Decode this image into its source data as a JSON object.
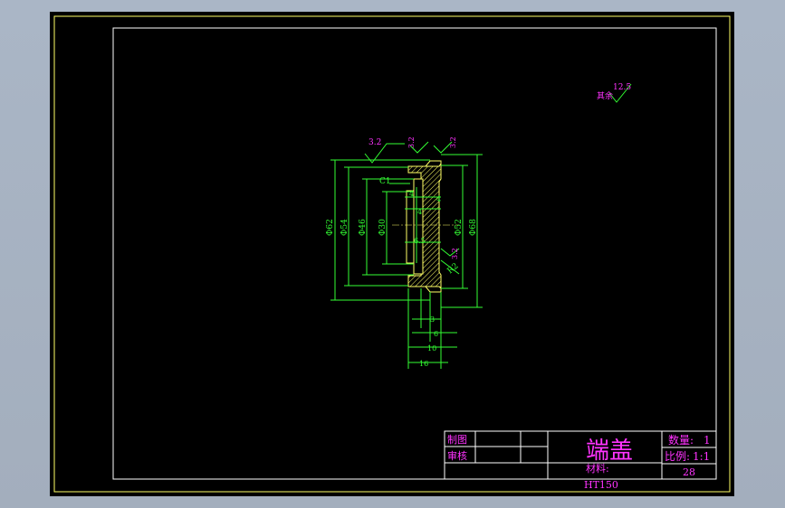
{
  "drawing": {
    "title": "端盖",
    "material_label": "材料:",
    "material": "HT150",
    "qty_label": "数量:",
    "qty": "1",
    "scale_label": "比例:",
    "scale": "1:1",
    "sheet_no": "28",
    "drawn_label": "制图",
    "review_label": "审核"
  },
  "roughness": {
    "general_label": "其余",
    "general_value": "12.5",
    "r1": "3.2",
    "r2": "3.2",
    "r3": "3.2",
    "r4": "3.2"
  },
  "dims": {
    "d62": "Φ62",
    "d54": "Φ54",
    "d46": "Φ46",
    "d30": "Φ30",
    "d52": "Φ52",
    "d68": "Φ68",
    "chamfer": "C1",
    "r2": "R2",
    "w4a": "4",
    "w4b": "4",
    "w4c": "4",
    "w6p5": "6.5",
    "l3": "3",
    "l6": "6",
    "l10": "10",
    "l16": "16"
  },
  "colors": {
    "background": "#000000",
    "frame": "#ffff66",
    "lines": "#33ff33",
    "text": "#ff33ff",
    "hatch": "#ffff66",
    "viewport": "#a9b4c3"
  }
}
